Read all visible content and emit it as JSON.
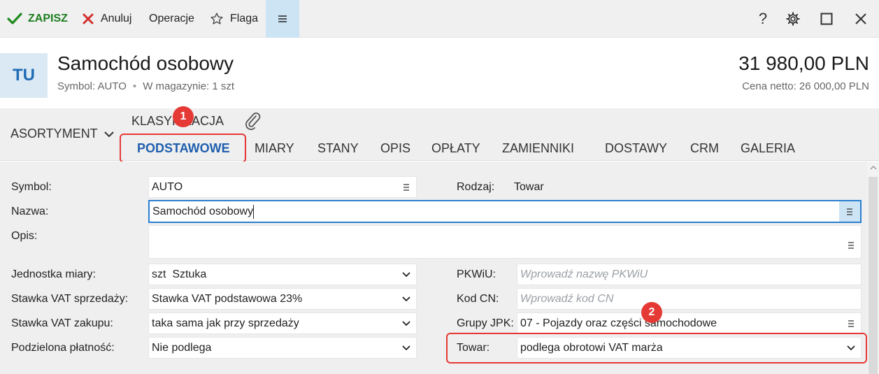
{
  "toolbar": {
    "save_label": "ZAPISZ",
    "cancel_label": "Anuluj",
    "operations_label": "Operacje",
    "flag_label": "Flaga",
    "menu_icon": "hamburger-icon",
    "help_label": "?"
  },
  "header": {
    "avatar_text": "TU",
    "title": "Samochód osobowy",
    "symbol_text": "Symbol: AUTO",
    "stock_text": "W magazynie: 1 szt",
    "price": "31 980,00 PLN",
    "netto": "Cena netto: 26 000,00 PLN"
  },
  "tabs": {
    "asortyment": "ASORTYMENT",
    "klasyfikacja": "KLASYFIKACJA",
    "items": [
      "PODSTAWOWE",
      "MIARY",
      "STANY",
      "OPIS",
      "OPŁATY",
      "ZAMIENNIKI",
      "DOSTAWY",
      "CRM",
      "GALERIA"
    ],
    "active": "PODSTAWOWE"
  },
  "badges": {
    "one": "1",
    "two": "2"
  },
  "form": {
    "symbol": {
      "label": "Symbol:",
      "value": "AUTO"
    },
    "rodzaj": {
      "label": "Rodzaj:",
      "value": "Towar"
    },
    "nazwa": {
      "label": "Nazwa:",
      "value": "Samochód osobowy"
    },
    "opis": {
      "label": "Opis:",
      "value": ""
    },
    "jednostka": {
      "label": "Jednostka miary:",
      "value": "szt  Sztuka"
    },
    "vat_sprzedazy": {
      "label": "Stawka VAT sprzedaży:",
      "value": "Stawka VAT podstawowa 23%"
    },
    "vat_zakupu": {
      "label": "Stawka VAT zakupu:",
      "value": "taka sama jak przy sprzedaży"
    },
    "podzielona": {
      "label": "Podzielona płatność:",
      "value": "Nie podlega"
    },
    "pkwiu": {
      "label": "PKWiU:",
      "placeholder": "Wprowadź nazwę PKWiU"
    },
    "kod_cn": {
      "label": "Kod CN:",
      "placeholder": "Wprowadź kod CN"
    },
    "grupy_jpk": {
      "label": "Grupy JPK:",
      "value": "07 - Pojazdy oraz części samochodowe"
    },
    "towar": {
      "label": "Towar:",
      "value": "podlega obrotowi VAT marża"
    }
  }
}
